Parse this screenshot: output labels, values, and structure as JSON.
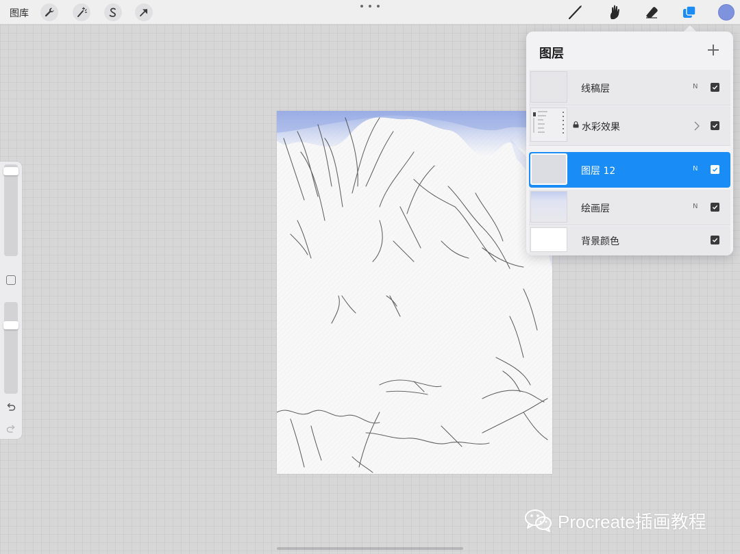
{
  "toolbar": {
    "gallery_label": "图库",
    "left_tools": [
      {
        "name": "wrench-icon"
      },
      {
        "name": "magic-wand-icon"
      },
      {
        "name": "selection-s-icon"
      },
      {
        "name": "transform-arrow-icon"
      }
    ],
    "right_tools": [
      {
        "name": "brush-icon"
      },
      {
        "name": "smudge-icon"
      },
      {
        "name": "eraser-icon"
      },
      {
        "name": "layers-icon",
        "active": true
      }
    ],
    "active_tool_color": "#1a8cf5",
    "current_color": "#7e92de"
  },
  "sidebar": {
    "brush_size": 0.05,
    "opacity": 0.2
  },
  "layers_panel": {
    "title": "图层",
    "add_icon": "plus-icon",
    "layers": [
      {
        "name": "线稿层",
        "blend": "N",
        "visible": true,
        "selected": false,
        "locked": false,
        "group": false
      },
      {
        "name": "水彩效果",
        "blend": "",
        "visible": true,
        "selected": false,
        "locked": true,
        "group": true
      },
      {
        "name": "图层 12",
        "blend": "N",
        "visible": true,
        "selected": true,
        "locked": false,
        "group": false
      },
      {
        "name": "绘画层",
        "blend": "N",
        "visible": true,
        "selected": false,
        "locked": false,
        "group": false
      },
      {
        "name": "背景颜色",
        "blend": "",
        "visible": true,
        "selected": false,
        "locked": false,
        "group": false
      }
    ]
  },
  "watermark": {
    "text": "Procreate插画教程"
  }
}
